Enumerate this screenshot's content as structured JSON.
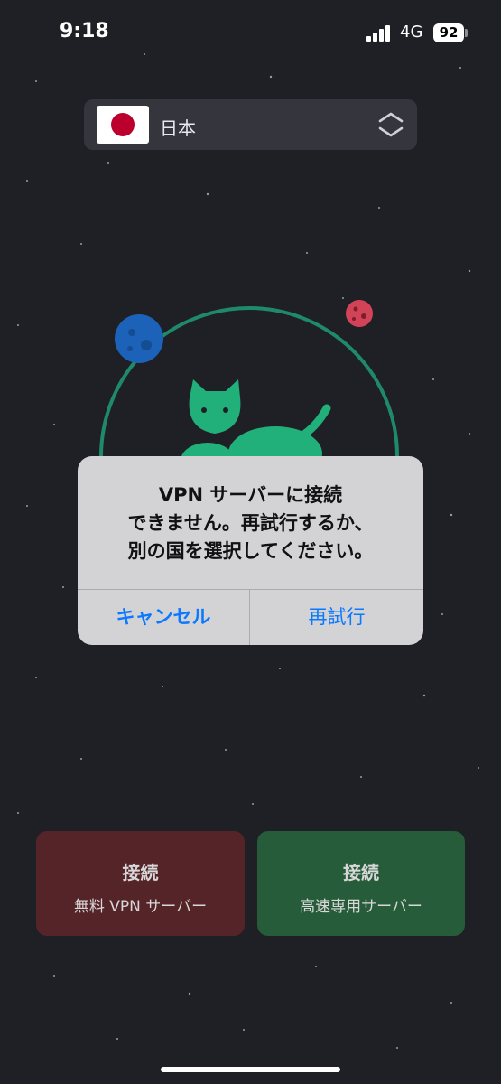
{
  "status_bar": {
    "time": "9:18",
    "network": "4G",
    "battery": "92"
  },
  "country_selector": {
    "country_name": "日本",
    "flag_icon": "japan-flag-icon",
    "toggle_icon": "chevron-up-down-icon"
  },
  "alert": {
    "message_line1": "VPN サーバーに接続",
    "message_line2": "できません。再試行するか、",
    "message_line3": "別の国を選択してください。",
    "cancel_label": "キャンセル",
    "retry_label": "再試行"
  },
  "buttons": {
    "free": {
      "title": "接続",
      "subtitle": "無料 VPN サーバー"
    },
    "fast": {
      "title": "接続",
      "subtitle": "高速専用サーバー"
    }
  },
  "colors": {
    "background": "#1f1f26",
    "accent_blue": "#0a78ff",
    "free_button": "#552428",
    "fast_button": "#275c3a",
    "cat_green": "#22b07a"
  }
}
